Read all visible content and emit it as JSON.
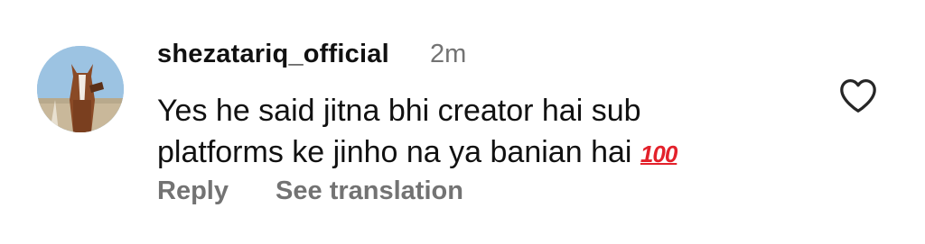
{
  "comment": {
    "username": "shezatariq_official",
    "time": "2m",
    "text_line1": "Yes he said jitna bhi creator hai sub",
    "text_line2": "platforms ke jinho na ya banian hai",
    "emoji": "💯",
    "emoji_glyph": "100",
    "avatar_icon": "horse-avatar",
    "like_icon": "heart-outline-icon"
  },
  "actions": {
    "reply_label": "Reply",
    "translate_label": "See translation"
  }
}
